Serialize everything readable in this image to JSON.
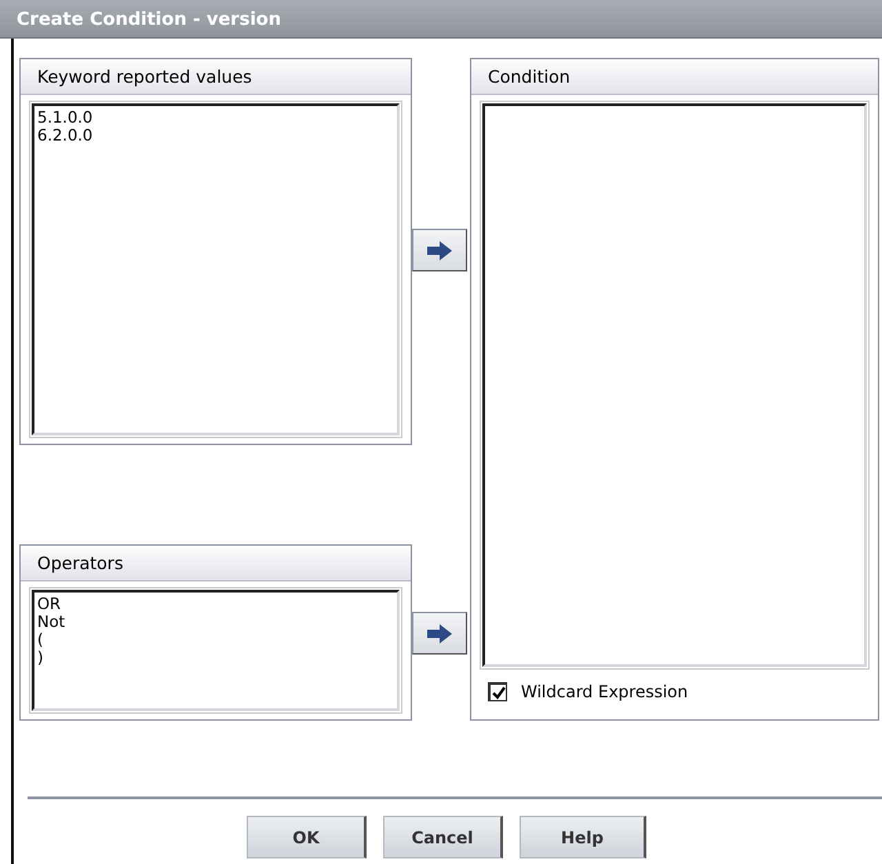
{
  "window": {
    "title": "Create Condition - version"
  },
  "keyword_panel": {
    "title": "Keyword reported values",
    "items": [
      "5.1.0.0",
      "6.2.0.0"
    ]
  },
  "operators_panel": {
    "title": "Operators",
    "items": [
      "OR",
      "Not",
      "(",
      ")"
    ]
  },
  "condition_panel": {
    "title": "Condition"
  },
  "wildcard": {
    "label": "Wildcard Expression",
    "checked": true
  },
  "buttons": [
    "OK",
    "Cancel",
    "Help"
  ]
}
